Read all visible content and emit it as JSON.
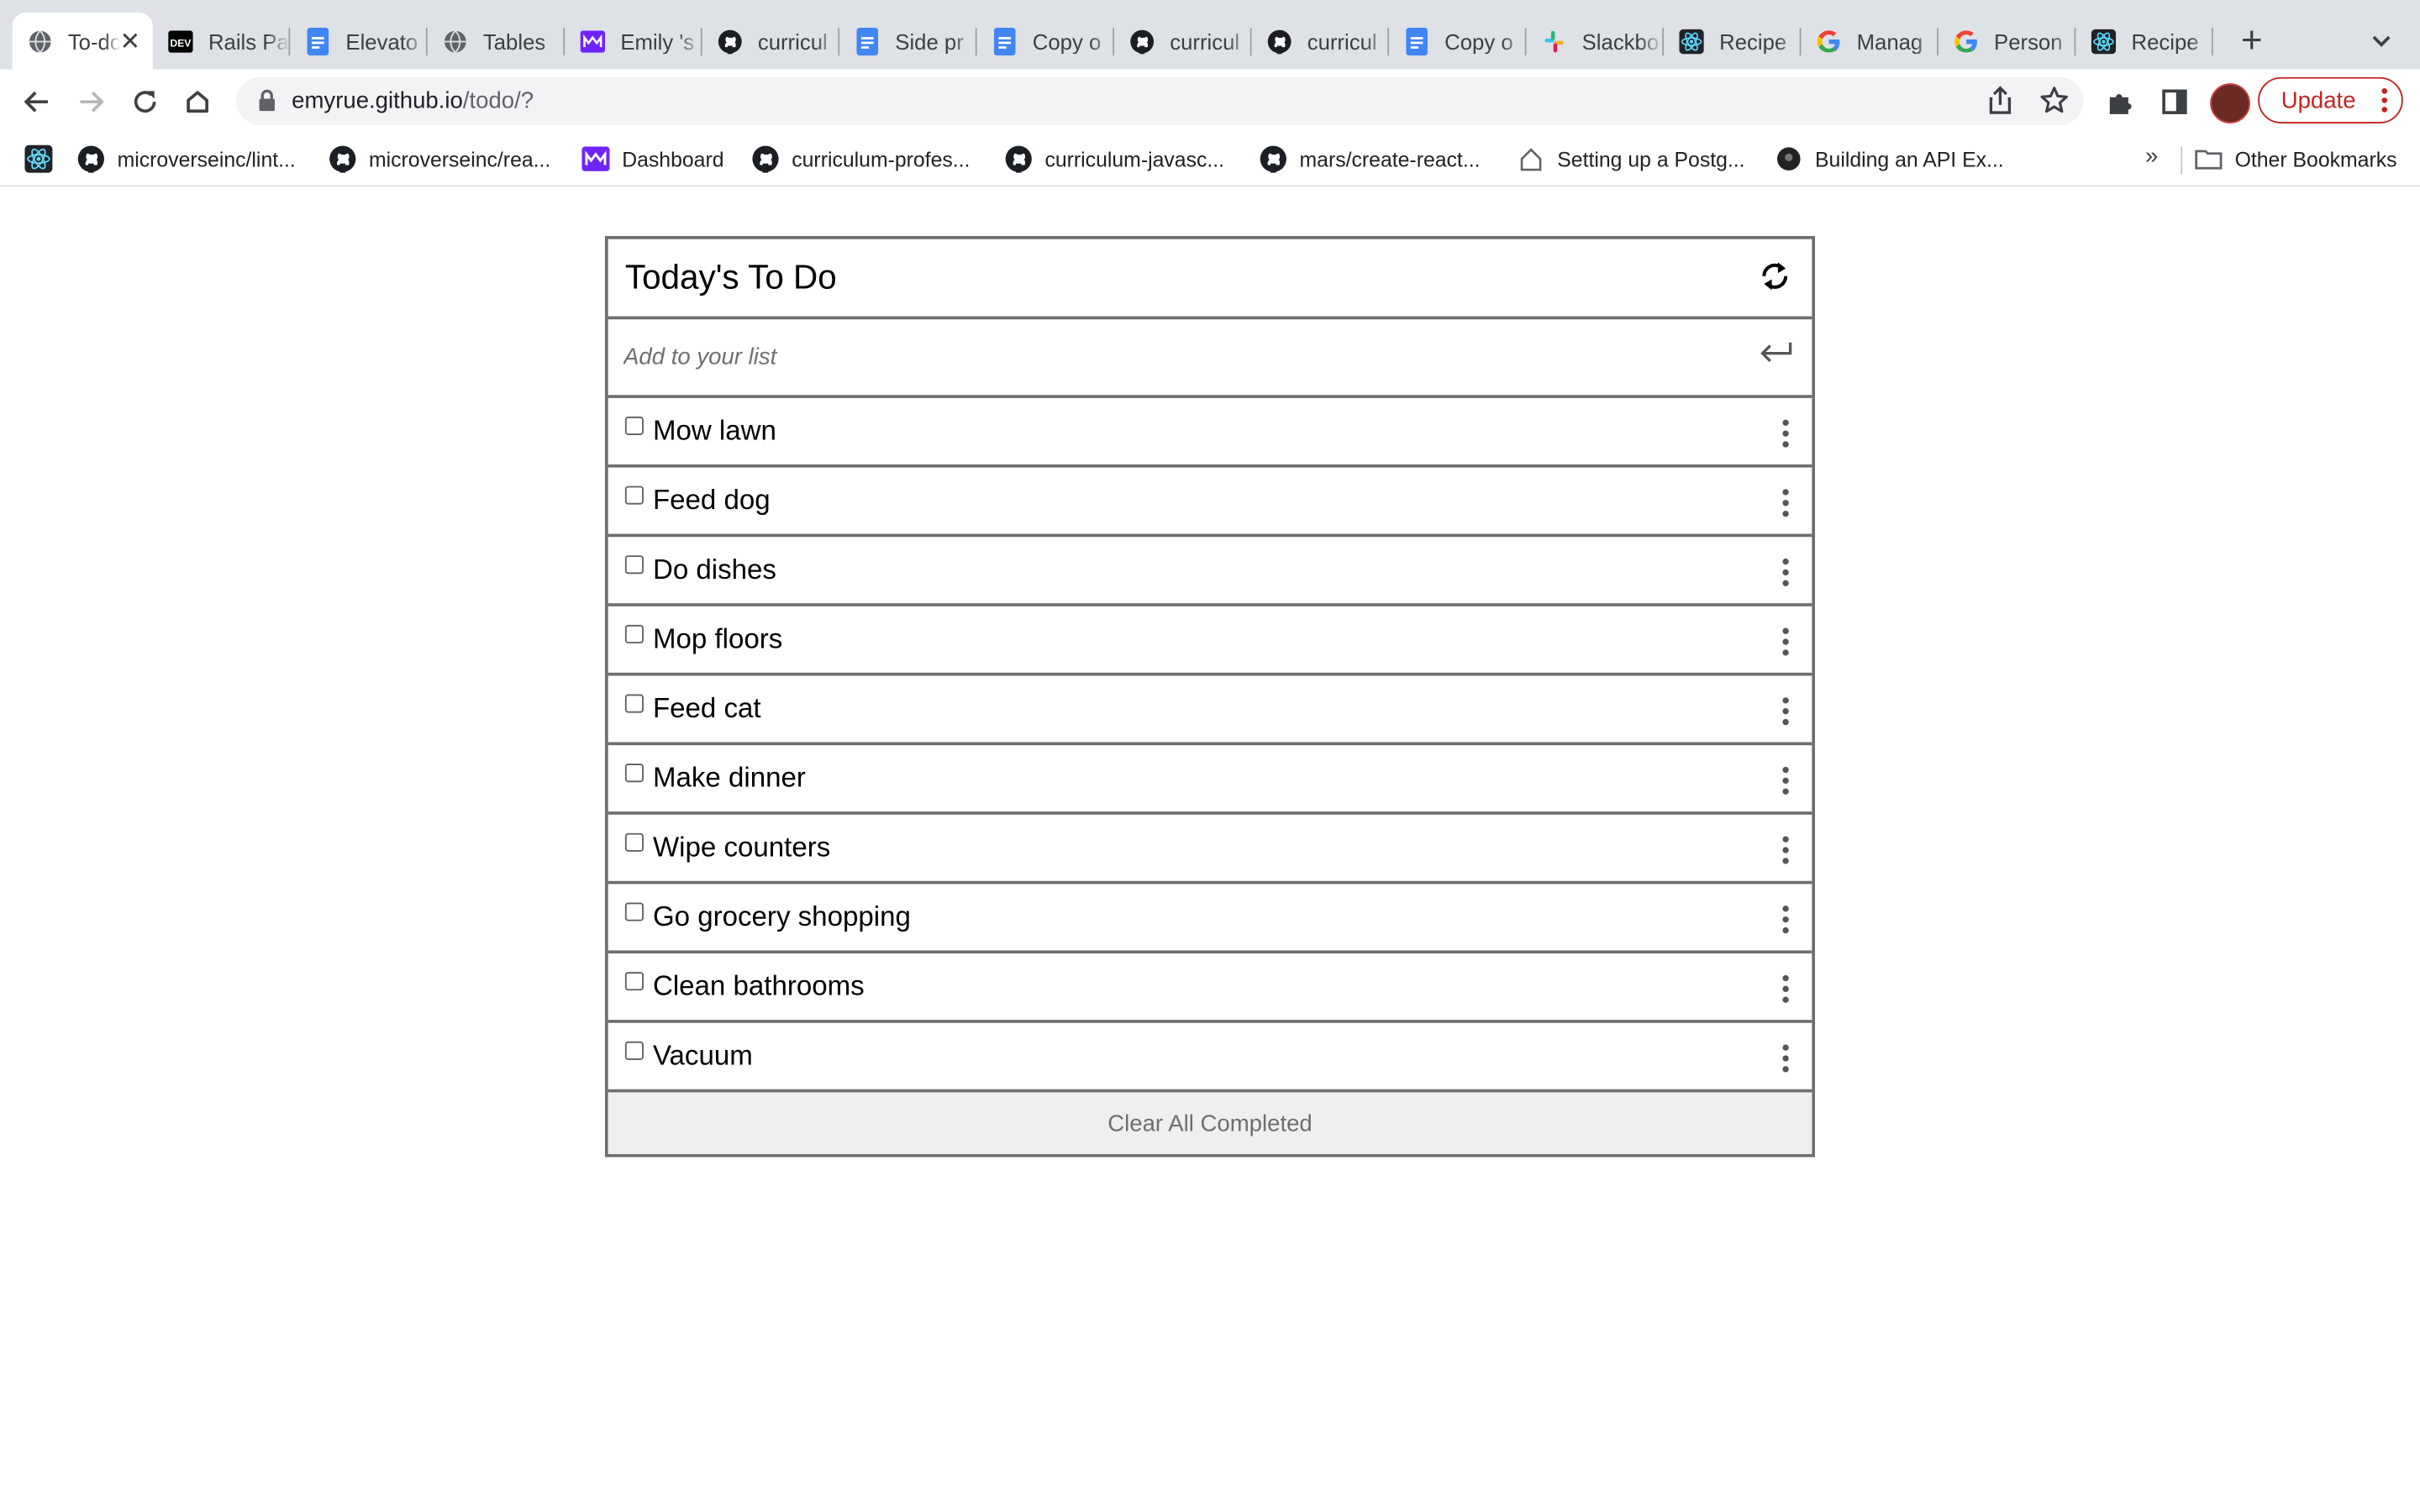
{
  "browser": {
    "tabs": [
      {
        "label": "To-do list",
        "icon": "globe-icon",
        "active": true
      },
      {
        "label": "Rails Pa",
        "icon": "dev-icon"
      },
      {
        "label": "Elevato",
        "icon": "docs-icon"
      },
      {
        "label": "Tables",
        "icon": "globe-icon"
      },
      {
        "label": "Emily 's",
        "icon": "microverse-icon"
      },
      {
        "label": "curricul",
        "icon": "github-icon"
      },
      {
        "label": "Side pr",
        "icon": "docs-icon"
      },
      {
        "label": "Copy o",
        "icon": "docs-icon"
      },
      {
        "label": "curricul",
        "icon": "github-icon"
      },
      {
        "label": "curricul",
        "icon": "github-icon"
      },
      {
        "label": "Copy o",
        "icon": "docs-icon"
      },
      {
        "label": "Slackbo",
        "icon": "slack-icon"
      },
      {
        "label": "Recipe",
        "icon": "react-icon"
      },
      {
        "label": "Manag",
        "icon": "google-icon"
      },
      {
        "label": "Person",
        "icon": "google-icon"
      },
      {
        "label": "Recipe",
        "icon": "react-icon"
      }
    ],
    "new_tab": "+",
    "url_host": "emyrue.github.io",
    "url_path": "/todo/?",
    "update_label": "Update",
    "bookmarks": [
      {
        "label": "",
        "icon": "react-icon"
      },
      {
        "label": "microverseinc/lint...",
        "icon": "github-icon"
      },
      {
        "label": "microverseinc/rea...",
        "icon": "github-icon"
      },
      {
        "label": "Dashboard",
        "icon": "microverse-icon"
      },
      {
        "label": "curriculum-profes...",
        "icon": "github-icon"
      },
      {
        "label": "curriculum-javasc...",
        "icon": "github-icon"
      },
      {
        "label": "mars/create-react...",
        "icon": "github-icon"
      },
      {
        "label": "Setting up a Postg...",
        "icon": "house-icon"
      },
      {
        "label": "Building an API Ex...",
        "icon": "dark-circle-icon"
      }
    ],
    "bookmarks_more": "»",
    "other_bookmarks": "Other Bookmarks"
  },
  "todo": {
    "title": "Today's To Do",
    "add_placeholder": "Add to your list",
    "items": [
      {
        "description": "Mow lawn",
        "completed": false
      },
      {
        "description": "Feed dog",
        "completed": false
      },
      {
        "description": "Do dishes",
        "completed": false
      },
      {
        "description": "Mop floors",
        "completed": false
      },
      {
        "description": "Feed cat",
        "completed": false
      },
      {
        "description": "Make dinner",
        "completed": false
      },
      {
        "description": "Wipe counters",
        "completed": false
      },
      {
        "description": "Go grocery shopping",
        "completed": false
      },
      {
        "description": "Clean bathrooms",
        "completed": false
      },
      {
        "description": "Vacuum",
        "completed": false
      }
    ],
    "clear_label": "Clear All Completed"
  },
  "colors": {
    "tabstrip_bg": "#dee1e6",
    "omnibox_bg": "#f1f3f4",
    "update_red": "#c5221f",
    "app_border": "#6e6e6e",
    "clear_bg": "#efefef"
  }
}
